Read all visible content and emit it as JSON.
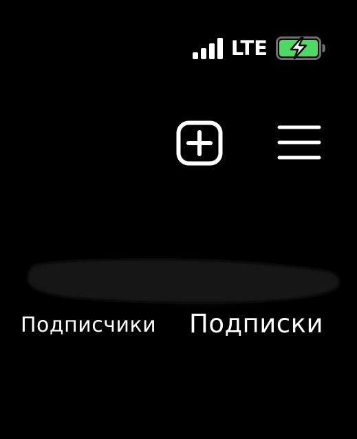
{
  "status_bar": {
    "network_type": "LTE",
    "battery_color": "#4cd964",
    "icons": [
      "cellular-signal-icon",
      "battery-charging-icon"
    ]
  },
  "header": {
    "icons": [
      "plus-square-icon",
      "hamburger-menu-icon"
    ]
  },
  "tabs": [
    {
      "label": "Подписчики"
    },
    {
      "label": "Подписки"
    }
  ],
  "colors": {
    "background": "#000000",
    "foreground": "#ffffff",
    "redaction": "#141414"
  }
}
